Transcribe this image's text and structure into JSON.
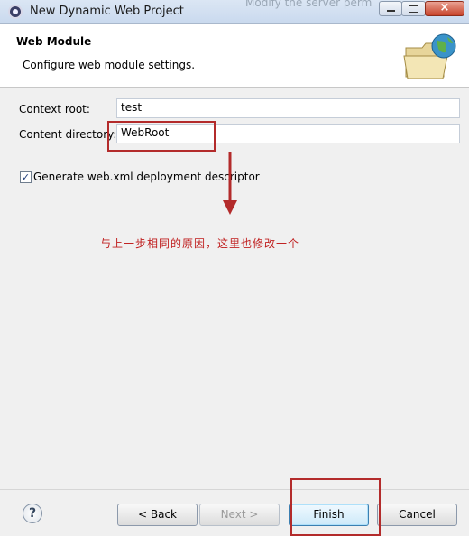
{
  "window": {
    "title": "New Dynamic Web Project",
    "background_text": "Modify the server perm"
  },
  "header": {
    "title": "Web Module",
    "description": "Configure web module settings."
  },
  "form": {
    "context_root_label": "Context root:",
    "context_root_value": "test",
    "content_directory_label": "Content directory:",
    "content_directory_value": "WebRoot",
    "generate_descriptor_label": "Generate web.xml deployment descriptor",
    "generate_descriptor_checked": true
  },
  "annotation": {
    "note": "与上一步相同的原因，这里也修改一个",
    "color": "#b32b2b"
  },
  "buttons": {
    "help": "?",
    "back": "< Back",
    "next": "Next >",
    "finish": "Finish",
    "cancel": "Cancel"
  },
  "colors": {
    "accent": "#3c7fb1",
    "annotation_red": "#b32b2b"
  }
}
